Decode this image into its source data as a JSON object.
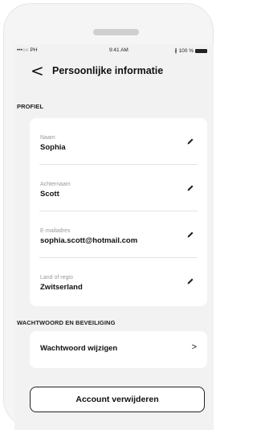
{
  "status_bar": {
    "carrier": "•••○○ PH",
    "time": "9:41 AM",
    "bluetooth": "∦",
    "battery_label": "100 %",
    "battery_level": 1.0
  },
  "header": {
    "back_label": "<",
    "title": "Persoonlijke informatie"
  },
  "profile": {
    "section_label": "PROFIEL",
    "fields": [
      {
        "label": "Naam",
        "value": "Sophia"
      },
      {
        "label": "Achternaam",
        "value": "Scott"
      },
      {
        "label": "E-mailadres",
        "value": "sophia.scott@hotmail.com"
      },
      {
        "label": "Land of regio",
        "value": "Zwitserland"
      }
    ]
  },
  "security": {
    "section_label": "WACHTWOORD EN BEVEILIGING",
    "change_password_label": "Wachtwoord wijzigen",
    "chevron": ">"
  },
  "delete_account_label": "Account verwijderen",
  "icons": {
    "edit": "pencil-icon",
    "wifi": "wifi-icon",
    "bluetooth": "bluetooth-icon",
    "battery": "battery-icon"
  }
}
